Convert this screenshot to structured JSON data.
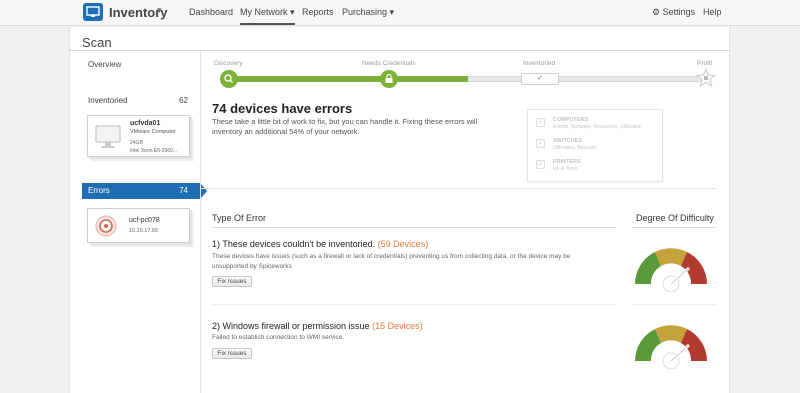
{
  "topbar": {
    "app_title": "Inventory",
    "app_caret": "▾",
    "nav": [
      "Dashboard",
      "My Network ▾",
      "Reports",
      "Purchasing ▾"
    ],
    "settings_label": "⚙ Settings",
    "help_label": "Help",
    "brand_color": "#1f6eb5"
  },
  "page": {
    "title": "Scan"
  },
  "sidebar": {
    "overview_label": "Overview",
    "inventoried_label": "Inventoried",
    "inventoried_count": "62",
    "inv_card": {
      "name": "ucfvda01",
      "type": "VMware Computer",
      "ram": "24GB",
      "cpu": "Intel Xeon E5-2660..."
    },
    "errors_label": "Errors",
    "errors_count": "74",
    "err_card": {
      "name": "ucf-pc078",
      "ip": "10.20.17.65"
    }
  },
  "progress": {
    "steps": [
      "Discovery",
      "Needs Credentials",
      "Inventoried",
      "Profit"
    ],
    "completed_fraction": 0.5,
    "fill_color": "#7cb23a"
  },
  "summary": {
    "title": "74 devices have errors",
    "desc": "These take a little bit of work to fix, but you can handle it. Fixing these errors will inventory an additional 54% of your network."
  },
  "inventoried_panel": [
    {
      "head": "COMPUTERS",
      "sub": "Events, Software, Resources, Utilization"
    },
    {
      "head": "SWITCHES",
      "sub": "Utilization, Backups"
    },
    {
      "head": "PRINTERS",
      "sub": "Ink & Toner"
    }
  ],
  "errors": {
    "type_header": "Type Of Error",
    "difficulty_header": "Degree Of Difficulty",
    "items": [
      {
        "title": "1) These devices couldn't be inventoried.",
        "count": "(59 Devices)",
        "desc": "These devices have issues (such as a firewall or lack of credentials) preventing us from collecting data, or the device may be unsupported by Spiceworks",
        "button": "Fix Issues",
        "difficulty": 0.75
      },
      {
        "title": "2) Windows firewall or permission issue",
        "count": "(15 Devices)",
        "desc": "Failed to establish connection to WMI service.",
        "button": "Fix Issues",
        "difficulty": 0.75
      }
    ]
  }
}
